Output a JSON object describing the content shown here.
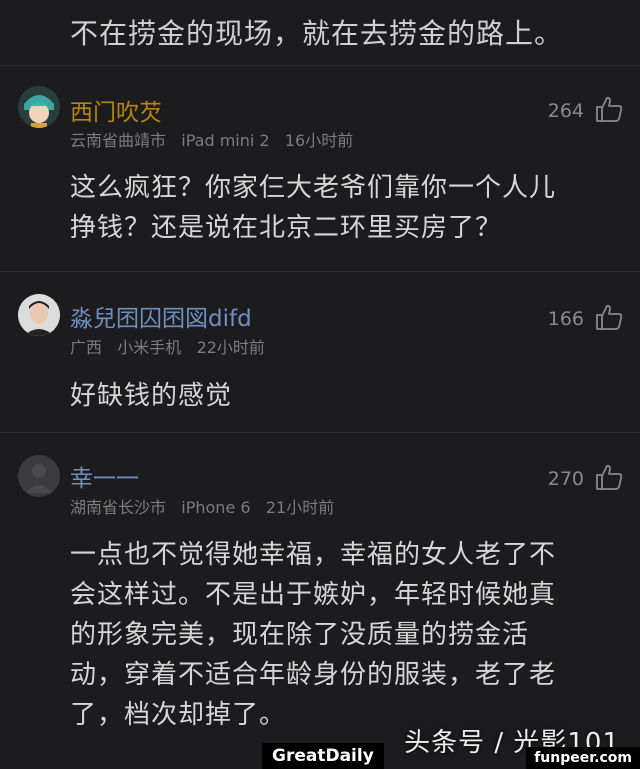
{
  "intro_text": "不在捞金的现场，就在去捞金的路上。",
  "comments": [
    {
      "username": "西门吹芡",
      "username_color": "#b8860b",
      "location": "云南省曲靖市",
      "device": "iPad mini 2",
      "time": "16小时前",
      "likes": "264",
      "avatar_icon": "anime-avatar-icon",
      "lines": [
        "这么疯狂？你家仨大老爷们靠你一个人儿",
        "挣钱？还是说在北京二环里买房了？"
      ]
    },
    {
      "username": "淼兒囨囚囨図difd",
      "username_color": "#6e8fbf",
      "location": "广西",
      "device": "小米手机",
      "time": "22小时前",
      "likes": "166",
      "avatar_icon": "person-avatar-icon",
      "lines": [
        "好缺钱的感觉"
      ]
    },
    {
      "username": "幸一一",
      "username_color": "#6e8fbf",
      "location": "湖南省长沙市",
      "device": "iPhone 6",
      "time": "21小时前",
      "likes": "270",
      "avatar_icon": "default-avatar-icon",
      "lines": [
        "一点也不觉得她幸福，幸福的女人老了不",
        "会这样过。不是出于嫉妒，年轻时候她真",
        "的形象完美，现在除了没质量的捞金活",
        "动，穿着不适合年龄身份的服装，老了老",
        "了，档次却掉了。"
      ]
    }
  ],
  "watermark": "头条号 / 光影101",
  "badge_left": "GreatDaily",
  "badge_right": "funpeer.com"
}
